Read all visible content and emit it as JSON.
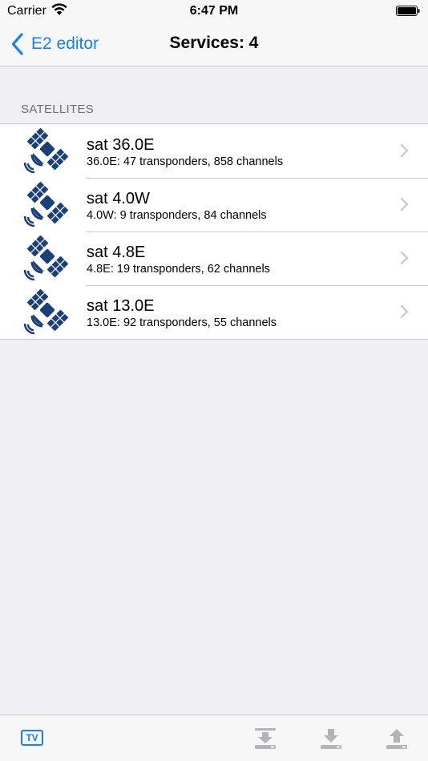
{
  "status_bar": {
    "carrier": "Carrier",
    "time": "6:47 PM"
  },
  "nav": {
    "back_label": "E2 editor",
    "title": "Services: 4"
  },
  "section": {
    "header": "SATELLITES"
  },
  "satellites": [
    {
      "title": "sat 36.0E",
      "subtitle": "36.0E: 47 transponders, 858 channels"
    },
    {
      "title": "sat 4.0W",
      "subtitle": "4.0W: 9 transponders, 84 channels"
    },
    {
      "title": "sat 4.8E",
      "subtitle": "4.8E: 19 transponders, 62 channels"
    },
    {
      "title": "sat 13.0E",
      "subtitle": "13.0E: 92 transponders, 55 channels"
    }
  ],
  "tab_bar": {
    "tv_label": "TV",
    "tools": [
      "import-icon",
      "download-icon",
      "upload-icon"
    ]
  },
  "colors": {
    "accent": "#147efb",
    "satellite_icon": "#1a3f7a",
    "background": "#efeff4",
    "disabled": "#b4b4b8"
  }
}
